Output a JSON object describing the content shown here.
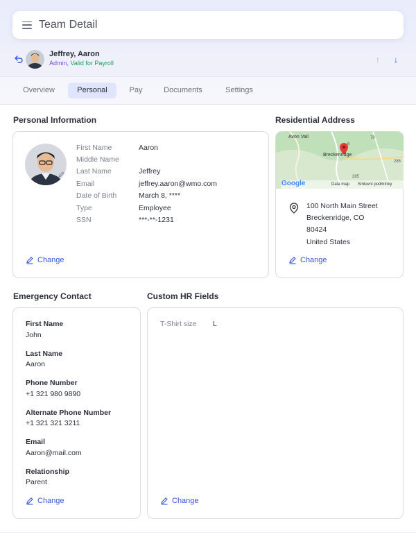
{
  "header": {
    "title": "Team Detail"
  },
  "user": {
    "name": "Jeffrey, Aaron",
    "role": "Admin",
    "separator": ",",
    "payroll_status": "Valid for Payroll"
  },
  "tabs": [
    {
      "label": "Overview",
      "active": false
    },
    {
      "label": "Personal",
      "active": true
    },
    {
      "label": "Pay",
      "active": false
    },
    {
      "label": "Documents",
      "active": false
    },
    {
      "label": "Settings",
      "active": false
    }
  ],
  "personal": {
    "title": "Personal Information",
    "fields": [
      {
        "label": "First Name",
        "value": "Aaron"
      },
      {
        "label": "Middle Name",
        "value": ""
      },
      {
        "label": "Last Name",
        "value": "Jeffrey"
      },
      {
        "label": "Email",
        "value": "jeffrey.aaron@wmo.com"
      },
      {
        "label": "Date of Birth",
        "value": "March 8, ****"
      },
      {
        "label": "Type",
        "value": "Employee"
      },
      {
        "label": "SSN",
        "value": "***-**-1231"
      }
    ],
    "change_label": "Change"
  },
  "address": {
    "title": "Residential Address",
    "map": {
      "labels": [
        "Avon Vail",
        "Breckenridge",
        "Google",
        "Data map",
        "Smluvní podmínky"
      ],
      "road_labels": [
        "6",
        "70",
        "285",
        "285"
      ]
    },
    "lines": [
      "100 North Main Street",
      "Breckenridge, CO",
      "80424",
      "United States"
    ],
    "change_label": "Change"
  },
  "emergency": {
    "title": "Emergency Contact",
    "fields": [
      {
        "label": "First Name",
        "value": "John"
      },
      {
        "label": "Last Name",
        "value": "Aaron"
      },
      {
        "label": "Phone Number",
        "value": "+1 321 980 9890"
      },
      {
        "label": "Alternate Phone Number",
        "value": "+1 321 321 3211"
      },
      {
        "label": "Email",
        "value": "Aaron@mail.com"
      },
      {
        "label": "Relationship",
        "value": "Parent"
      }
    ],
    "change_label": "Change"
  },
  "hr_fields": {
    "title": "Custom HR Fields",
    "fields": [
      {
        "label": "T-Shirt size",
        "value": "L"
      }
    ],
    "change_label": "Change"
  },
  "colors": {
    "accent": "#3a56d8",
    "role": "#7a4be0",
    "payroll": "#1a9e5a",
    "active_tab_bg": "#dfe6fb"
  }
}
